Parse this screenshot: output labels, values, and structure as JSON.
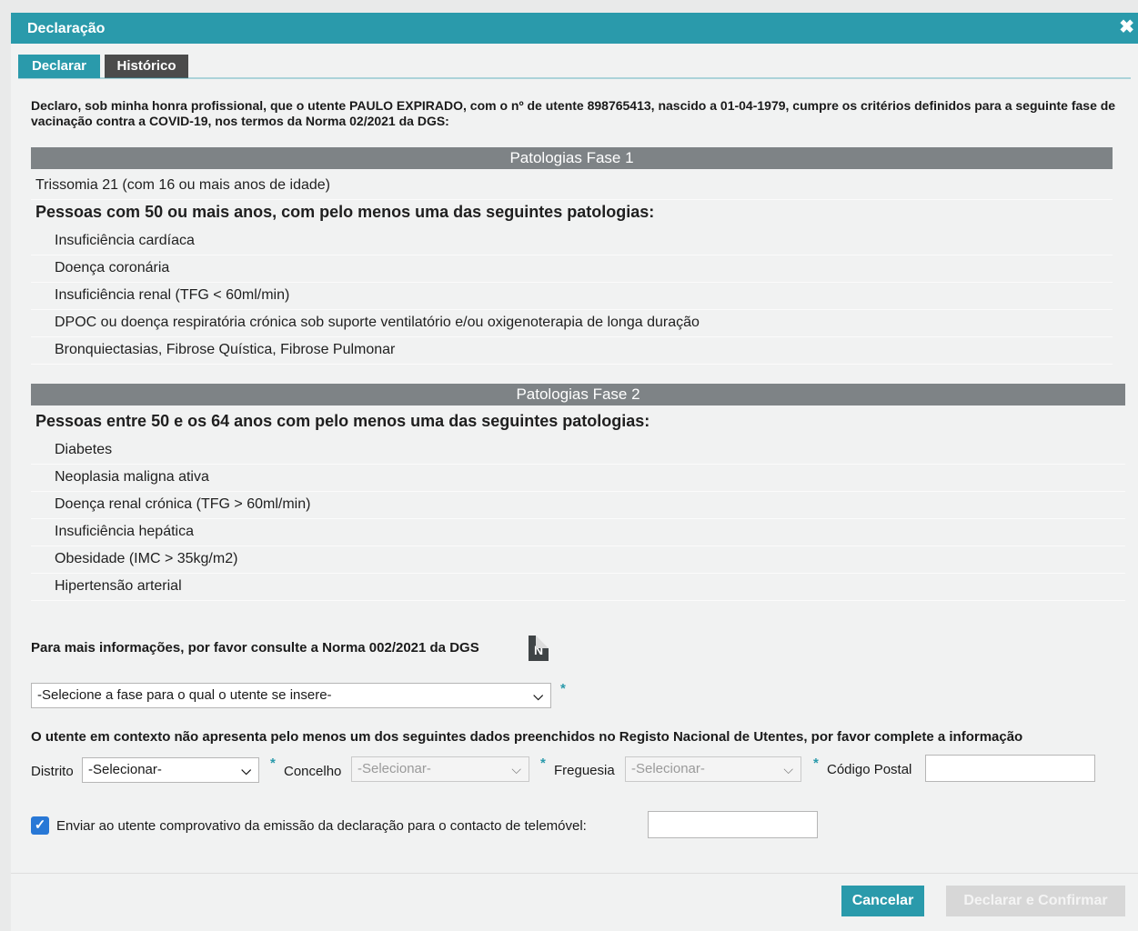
{
  "dialog": {
    "title": "Declaração",
    "close_icon": "close-icon",
    "tabs": [
      {
        "label": "Declarar",
        "active": true
      },
      {
        "label": "Histórico",
        "active": false
      }
    ]
  },
  "intro": "Declaro, sob minha honra profissional, que o utente PAULO EXPIRADO, com o nº de utente 898765413, nascido a 01-04-1979, cumpre os critérios definidos para a seguinte fase de vacinação contra a COVID-19, nos termos da Norma 02/2021 da DGS:",
  "phase1": {
    "header": "Patologias Fase 1",
    "row_trissomia": "Trissomia 21 (com 16 ou mais anos de idade)",
    "group_label": "Pessoas com 50 ou mais anos, com pelo menos uma das seguintes patologias:",
    "items": [
      "Insuficiência cardíaca",
      "Doença coronária",
      "Insuficiência renal (TFG < 60ml/min)",
      "DPOC ou doença respiratória crónica sob suporte ventilatório e/ou oxigenoterapia de longa duração",
      "Bronquiectasias, Fibrose Quística, Fibrose Pulmonar"
    ]
  },
  "phase2": {
    "header": "Patologias Fase 2",
    "group_label": "Pessoas entre 50 e os 64 anos com pelo menos uma das seguintes patologias:",
    "items": [
      "Diabetes",
      "Neoplasia maligna ativa",
      "Doença renal crónica (TFG > 60ml/min)",
      "Insuficiência hepática",
      "Obesidade (IMC > 35kg/m2)",
      "Hipertensão arterial"
    ]
  },
  "info_text": "Para mais informações, por favor consulte a Norma 002/2021 da DGS",
  "doc_icon_letter": "N",
  "phase_select": "-Selecione a fase para o qual o utente se insere-",
  "required_mark": "*",
  "warning": "O utente em contexto não apresenta pelo menos um dos seguintes dados preenchidos no Registo Nacional de Utentes, por favor complete a informação",
  "address": {
    "distrito_label": "Distrito",
    "distrito_value": "-Selecionar-",
    "concelho_label": "Concelho",
    "concelho_value": "-Selecionar-",
    "freguesia_label": "Freguesia",
    "freguesia_value": "-Selecionar-",
    "codigo_postal_label": "Código Postal",
    "codigo_postal_value": ""
  },
  "sms": {
    "checked": true,
    "check_glyph": "✓",
    "label": "Enviar ao utente comprovativo da emissão da declaração para o contacto de telemóvel:",
    "phone_value": ""
  },
  "buttons": {
    "cancel": "Cancelar",
    "confirm": "Declarar e Confirmar"
  },
  "colors": {
    "accent": "#2a9aab",
    "section_header": "#7e8386",
    "tab_inactive": "#4b4b4b"
  }
}
